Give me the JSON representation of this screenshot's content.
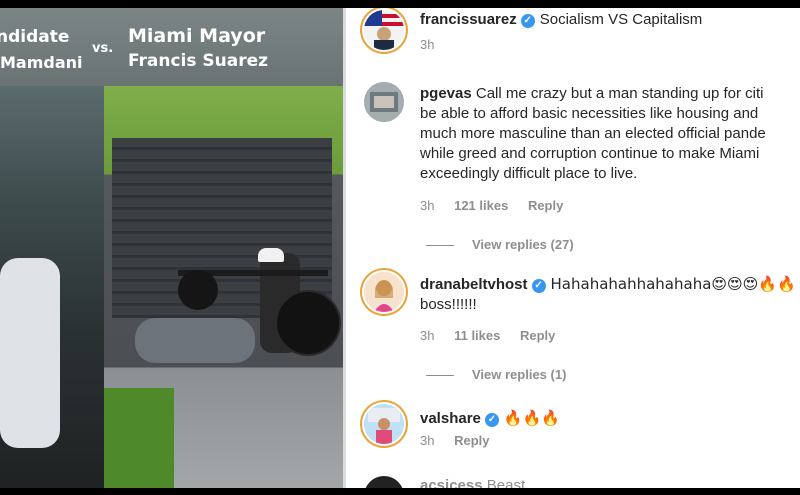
{
  "video": {
    "banner_left_line1": "ndidate",
    "banner_left_line2": "Mamdani",
    "banner_vs": "vs.",
    "banner_right_line1": "Miami Mayor",
    "banner_right_line2": "Francis Suarez"
  },
  "post": {
    "username": "francissuarez",
    "caption": "Socialism VS Capitalism",
    "time": "3h"
  },
  "comments": [
    {
      "username": "pgevas",
      "lines": [
        "Call me crazy but a man standing up for citi",
        "be able to afford basic necessities like housing and",
        "much more masculine than an elected official pande",
        "while greed and corruption continue to make Miami",
        "exceedingly difficult place to live."
      ],
      "time": "3h",
      "likes": "121 likes",
      "reply": "Reply",
      "view_replies": "View replies (27)"
    },
    {
      "username": "dranabeltvhost",
      "line1": "Hahahahahhahahaha😍😍😍🔥🔥",
      "line2": "boss!!!!!!",
      "time": "3h",
      "likes": "11 likes",
      "reply": "Reply",
      "view_replies": "View replies (1)"
    },
    {
      "username": "valshare",
      "text": "🔥🔥🔥",
      "time": "3h",
      "reply": "Reply"
    },
    {
      "username": "acsicess",
      "text": "Beast"
    }
  ],
  "colors": {
    "verified": "#3897f0",
    "meta": "#8e8e8e",
    "text": "#262626"
  }
}
